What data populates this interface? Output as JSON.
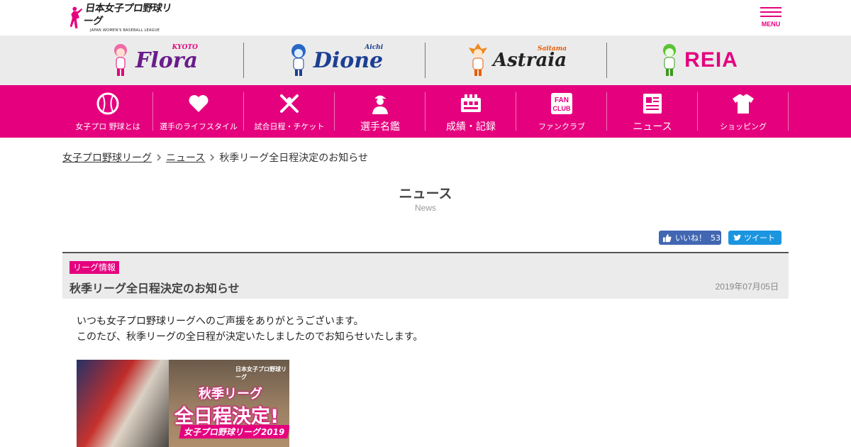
{
  "header": {
    "logo_text_jp": "日本女子プロ野球リーグ",
    "logo_text_en": "JAPAN WOMEN'S BASEBALL LEAGUE",
    "menu_label": "MENU"
  },
  "teams": [
    {
      "name": "Flora",
      "sub": "KYOTO"
    },
    {
      "name": "Dione",
      "sub": "Aichi"
    },
    {
      "name": "Astraia",
      "sub": "Saitama"
    },
    {
      "name": "REIA",
      "sub": ""
    }
  ],
  "nav": [
    {
      "label": "女子プロ 野球とは",
      "icon": "baseball-icon"
    },
    {
      "label": "選手のライフスタイル",
      "icon": "heart-icon"
    },
    {
      "label": "試合日程・チケット",
      "icon": "crossed-bats-icon"
    },
    {
      "label": "選手名鑑",
      "icon": "player-icon"
    },
    {
      "label": "成績・記録",
      "icon": "scoreboard-icon"
    },
    {
      "label": "ファンクラブ",
      "icon": "fan-club-icon",
      "icon_text": "FAN CLUB"
    },
    {
      "label": "ニュース",
      "icon": "newspaper-icon"
    },
    {
      "label": "ショッピング",
      "icon": "tshirt-icon"
    }
  ],
  "breadcrumb": [
    "女子プロ野球リーグ",
    "ニュース",
    "秋季リーグ全日程決定のお知らせ"
  ],
  "page": {
    "title": "ニュース",
    "subtitle": "News"
  },
  "social": {
    "like_label": "いいね！",
    "like_count": "53",
    "tweet_label": "ツイート"
  },
  "article": {
    "category": "リーグ情報",
    "title": "秋季リーグ全日程決定のお知らせ",
    "date": "2019年07月05日",
    "body": [
      "いつも女子プロ野球リーグへのご声援をありがとうございます。",
      "このたび、秋季リーグの全日程が決定いたしましたのでお知らせいたします。"
    ],
    "banner": {
      "line1": "秋季リーグ",
      "line2": "全日程決定!",
      "line3": "女子プロ野球リーグ2019",
      "logo": "日本女子プロ野球リーグ"
    }
  },
  "colors": {
    "brand_pink": "#e5007e",
    "team_bar": "#ebebeb",
    "facebook": "#4267b2",
    "twitter": "#1b95e0"
  }
}
